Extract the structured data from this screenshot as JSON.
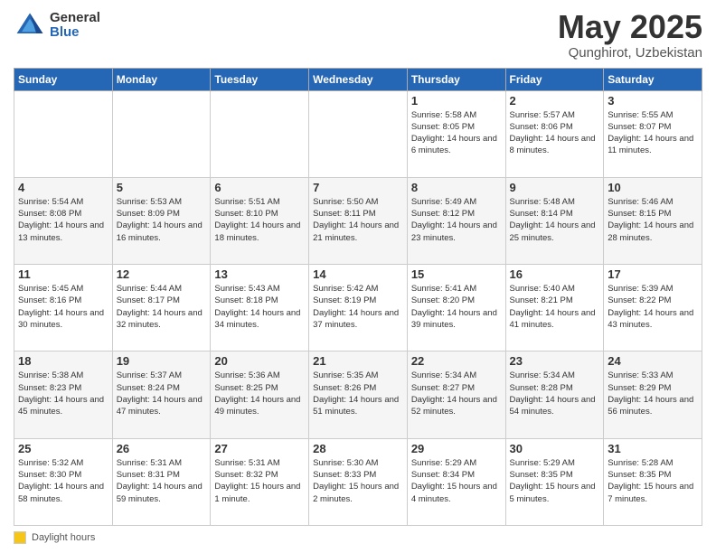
{
  "header": {
    "logo_general": "General",
    "logo_blue": "Blue",
    "month_title": "May 2025",
    "location": "Qunghirot, Uzbekistan"
  },
  "weekdays": [
    "Sunday",
    "Monday",
    "Tuesday",
    "Wednesday",
    "Thursday",
    "Friday",
    "Saturday"
  ],
  "legend": {
    "label": "Daylight hours"
  },
  "weeks": [
    [
      {
        "day": "",
        "info": ""
      },
      {
        "day": "",
        "info": ""
      },
      {
        "day": "",
        "info": ""
      },
      {
        "day": "",
        "info": ""
      },
      {
        "day": "1",
        "info": "Sunrise: 5:58 AM\nSunset: 8:05 PM\nDaylight: 14 hours\nand 6 minutes."
      },
      {
        "day": "2",
        "info": "Sunrise: 5:57 AM\nSunset: 8:06 PM\nDaylight: 14 hours\nand 8 minutes."
      },
      {
        "day": "3",
        "info": "Sunrise: 5:55 AM\nSunset: 8:07 PM\nDaylight: 14 hours\nand 11 minutes."
      }
    ],
    [
      {
        "day": "4",
        "info": "Sunrise: 5:54 AM\nSunset: 8:08 PM\nDaylight: 14 hours\nand 13 minutes."
      },
      {
        "day": "5",
        "info": "Sunrise: 5:53 AM\nSunset: 8:09 PM\nDaylight: 14 hours\nand 16 minutes."
      },
      {
        "day": "6",
        "info": "Sunrise: 5:51 AM\nSunset: 8:10 PM\nDaylight: 14 hours\nand 18 minutes."
      },
      {
        "day": "7",
        "info": "Sunrise: 5:50 AM\nSunset: 8:11 PM\nDaylight: 14 hours\nand 21 minutes."
      },
      {
        "day": "8",
        "info": "Sunrise: 5:49 AM\nSunset: 8:12 PM\nDaylight: 14 hours\nand 23 minutes."
      },
      {
        "day": "9",
        "info": "Sunrise: 5:48 AM\nSunset: 8:14 PM\nDaylight: 14 hours\nand 25 minutes."
      },
      {
        "day": "10",
        "info": "Sunrise: 5:46 AM\nSunset: 8:15 PM\nDaylight: 14 hours\nand 28 minutes."
      }
    ],
    [
      {
        "day": "11",
        "info": "Sunrise: 5:45 AM\nSunset: 8:16 PM\nDaylight: 14 hours\nand 30 minutes."
      },
      {
        "day": "12",
        "info": "Sunrise: 5:44 AM\nSunset: 8:17 PM\nDaylight: 14 hours\nand 32 minutes."
      },
      {
        "day": "13",
        "info": "Sunrise: 5:43 AM\nSunset: 8:18 PM\nDaylight: 14 hours\nand 34 minutes."
      },
      {
        "day": "14",
        "info": "Sunrise: 5:42 AM\nSunset: 8:19 PM\nDaylight: 14 hours\nand 37 minutes."
      },
      {
        "day": "15",
        "info": "Sunrise: 5:41 AM\nSunset: 8:20 PM\nDaylight: 14 hours\nand 39 minutes."
      },
      {
        "day": "16",
        "info": "Sunrise: 5:40 AM\nSunset: 8:21 PM\nDaylight: 14 hours\nand 41 minutes."
      },
      {
        "day": "17",
        "info": "Sunrise: 5:39 AM\nSunset: 8:22 PM\nDaylight: 14 hours\nand 43 minutes."
      }
    ],
    [
      {
        "day": "18",
        "info": "Sunrise: 5:38 AM\nSunset: 8:23 PM\nDaylight: 14 hours\nand 45 minutes."
      },
      {
        "day": "19",
        "info": "Sunrise: 5:37 AM\nSunset: 8:24 PM\nDaylight: 14 hours\nand 47 minutes."
      },
      {
        "day": "20",
        "info": "Sunrise: 5:36 AM\nSunset: 8:25 PM\nDaylight: 14 hours\nand 49 minutes."
      },
      {
        "day": "21",
        "info": "Sunrise: 5:35 AM\nSunset: 8:26 PM\nDaylight: 14 hours\nand 51 minutes."
      },
      {
        "day": "22",
        "info": "Sunrise: 5:34 AM\nSunset: 8:27 PM\nDaylight: 14 hours\nand 52 minutes."
      },
      {
        "day": "23",
        "info": "Sunrise: 5:34 AM\nSunset: 8:28 PM\nDaylight: 14 hours\nand 54 minutes."
      },
      {
        "day": "24",
        "info": "Sunrise: 5:33 AM\nSunset: 8:29 PM\nDaylight: 14 hours\nand 56 minutes."
      }
    ],
    [
      {
        "day": "25",
        "info": "Sunrise: 5:32 AM\nSunset: 8:30 PM\nDaylight: 14 hours\nand 58 minutes."
      },
      {
        "day": "26",
        "info": "Sunrise: 5:31 AM\nSunset: 8:31 PM\nDaylight: 14 hours\nand 59 minutes."
      },
      {
        "day": "27",
        "info": "Sunrise: 5:31 AM\nSunset: 8:32 PM\nDaylight: 15 hours\nand 1 minute."
      },
      {
        "day": "28",
        "info": "Sunrise: 5:30 AM\nSunset: 8:33 PM\nDaylight: 15 hours\nand 2 minutes."
      },
      {
        "day": "29",
        "info": "Sunrise: 5:29 AM\nSunset: 8:34 PM\nDaylight: 15 hours\nand 4 minutes."
      },
      {
        "day": "30",
        "info": "Sunrise: 5:29 AM\nSunset: 8:35 PM\nDaylight: 15 hours\nand 5 minutes."
      },
      {
        "day": "31",
        "info": "Sunrise: 5:28 AM\nSunset: 8:35 PM\nDaylight: 15 hours\nand 7 minutes."
      }
    ]
  ]
}
